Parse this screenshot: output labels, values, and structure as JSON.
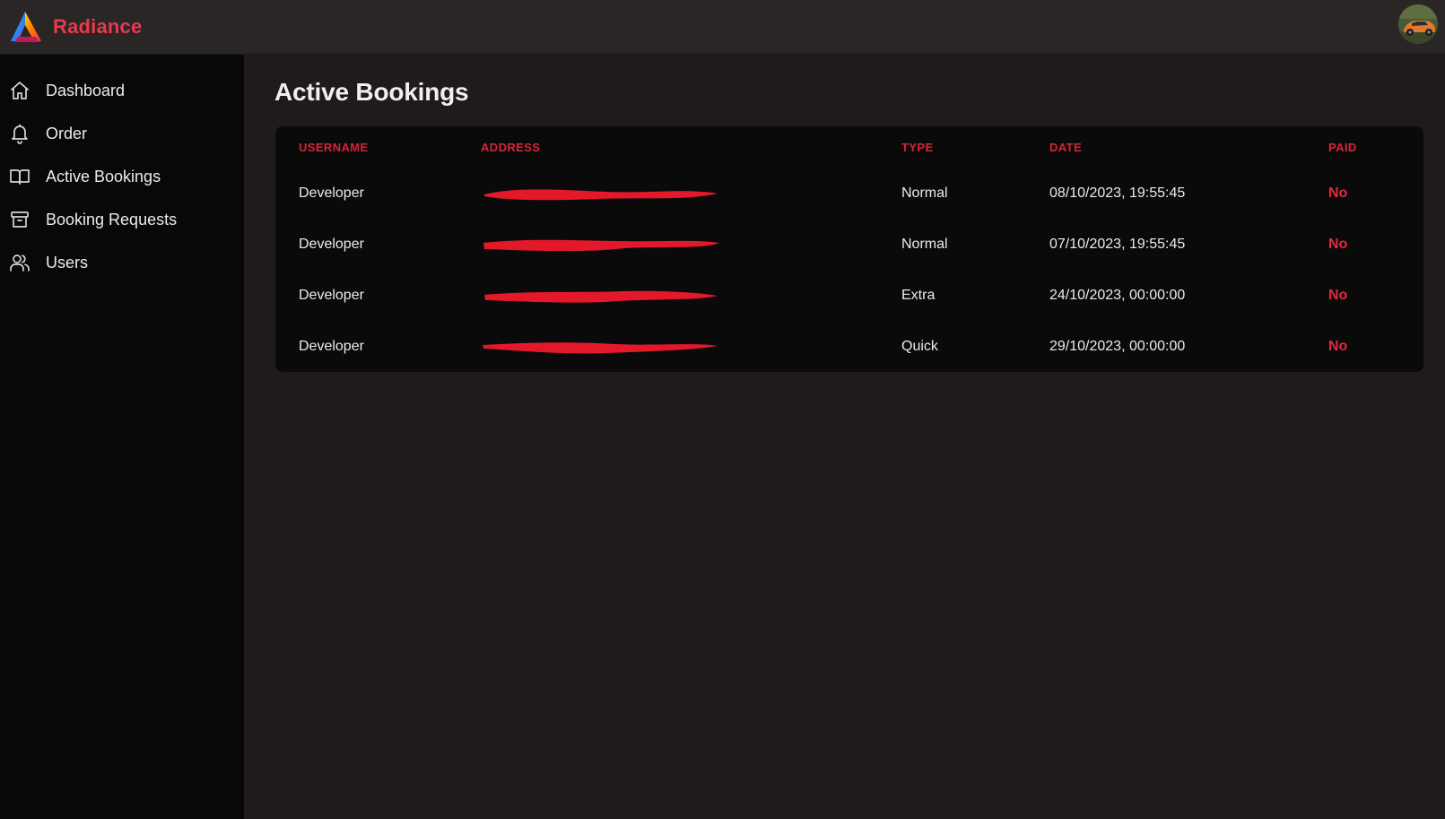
{
  "app": {
    "name": "Radiance",
    "accent_color": "#e8394f"
  },
  "user_menu": {
    "avatar_icon": "user-avatar-car-photo"
  },
  "sidebar": {
    "items": [
      {
        "label": "Dashboard",
        "icon": "home-icon"
      },
      {
        "label": "Order",
        "icon": "bell-icon"
      },
      {
        "label": "Active Bookings",
        "icon": "book-open-icon"
      },
      {
        "label": "Booking Requests",
        "icon": "archive-icon"
      },
      {
        "label": "Users",
        "icon": "users-icon"
      }
    ]
  },
  "main": {
    "title": "Active Bookings",
    "table": {
      "columns": [
        "USERNAME",
        "ADDRESS",
        "TYPE",
        "DATE",
        "PAID"
      ],
      "rows": [
        {
          "username": "Developer",
          "address": "",
          "type": "Normal",
          "date": "08/10/2023, 19:55:45",
          "paid": "No"
        },
        {
          "username": "Developer",
          "address": "",
          "type": "Normal",
          "date": "07/10/2023, 19:55:45",
          "paid": "No"
        },
        {
          "username": "Developer",
          "address": "",
          "type": "Extra",
          "date": "24/10/2023, 00:00:00",
          "paid": "No"
        },
        {
          "username": "Developer",
          "address": "",
          "type": "Quick",
          "date": "29/10/2023, 00:00:00",
          "paid": "No"
        }
      ],
      "header_color": "#d4253a",
      "unpaid_color": "#e3283f",
      "redaction_color": "#e3192b"
    }
  }
}
